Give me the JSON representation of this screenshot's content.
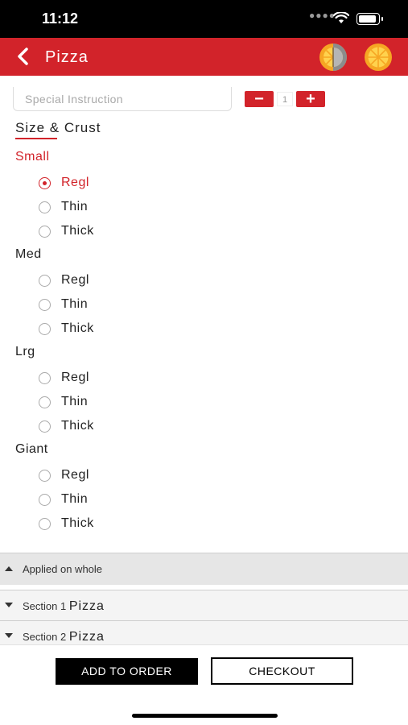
{
  "status_bar": {
    "time": "11:12"
  },
  "header": {
    "title": "Pizza"
  },
  "instruction": {
    "placeholder": "Special Instruction"
  },
  "quantity": {
    "minus": "−",
    "value": "1",
    "plus": "+"
  },
  "size_crust": {
    "title": "Size & Crust",
    "sizes": [
      {
        "label": "Small",
        "options": [
          "Regl",
          "Thin",
          "Thick"
        ]
      },
      {
        "label": "Med",
        "options": [
          "Regl",
          "Thin",
          "Thick"
        ]
      },
      {
        "label": "Lrg",
        "options": [
          "Regl",
          "Thin",
          "Thick"
        ]
      },
      {
        "label": "Giant",
        "options": [
          "Regl",
          "Thin",
          "Thick"
        ]
      }
    ],
    "selected": "Small / Regl"
  },
  "accordion": {
    "applied": "Applied on whole",
    "section1_prefix": "Section 1",
    "section1_name": "Pizza",
    "section2_prefix": "Section 2",
    "section2_name": "Pizza"
  },
  "actions": {
    "add": "ADD TO ORDER",
    "checkout": "CHECKOUT"
  },
  "colors": {
    "accent": "#d2232a",
    "icon_yellow": "#f6a623",
    "icon_gray": "#8c8c8c"
  },
  "icons": [
    "back-chevron",
    "half-pizza",
    "whole-pizza",
    "wifi",
    "battery",
    "radio",
    "triangle-up",
    "triangle-down"
  ]
}
